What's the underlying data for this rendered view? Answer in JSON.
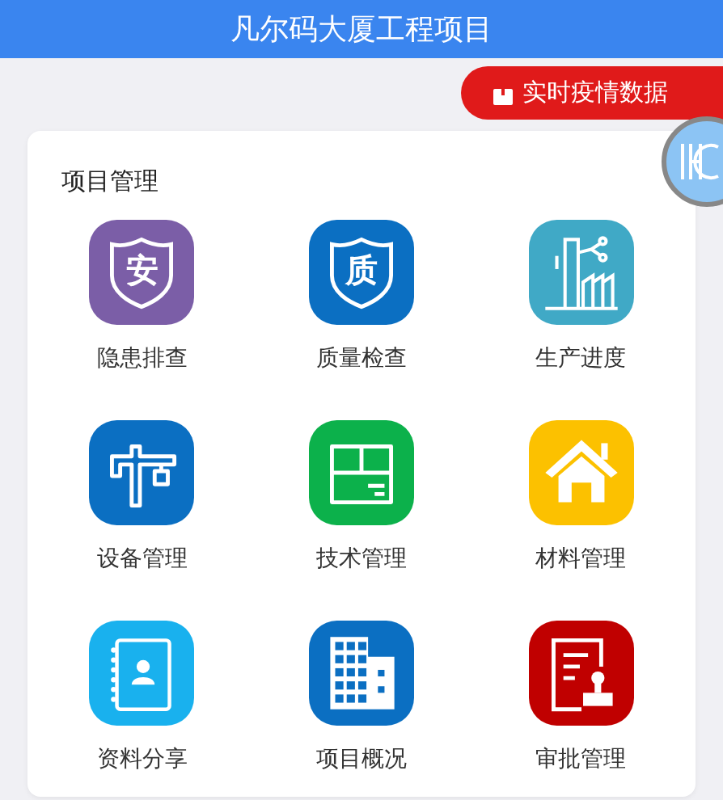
{
  "header": {
    "title": "凡尔码大厦工程项目"
  },
  "epidemic_button": {
    "label": "实时疫情数据"
  },
  "section": {
    "title": "项目管理",
    "items": [
      {
        "label": "隐患排查",
        "kind": "shield",
        "glyph": "安",
        "color": "#7b5ea7"
      },
      {
        "label": "质量检查",
        "kind": "shield",
        "glyph": "质",
        "color": "#0b6fc2"
      },
      {
        "label": "生产进度",
        "kind": "factory",
        "color": "#40a9c6"
      },
      {
        "label": "设备管理",
        "kind": "crane",
        "color": "#0b6fc2"
      },
      {
        "label": "技术管理",
        "kind": "box",
        "color": "#0cb14b"
      },
      {
        "label": "材料管理",
        "kind": "house",
        "color": "#fcc100"
      },
      {
        "label": "资料分享",
        "kind": "notebook",
        "color": "#19b1ee"
      },
      {
        "label": "项目概况",
        "kind": "building",
        "color": "#0b6fc2"
      },
      {
        "label": "审批管理",
        "kind": "stamp",
        "color": "#c00000"
      }
    ]
  }
}
